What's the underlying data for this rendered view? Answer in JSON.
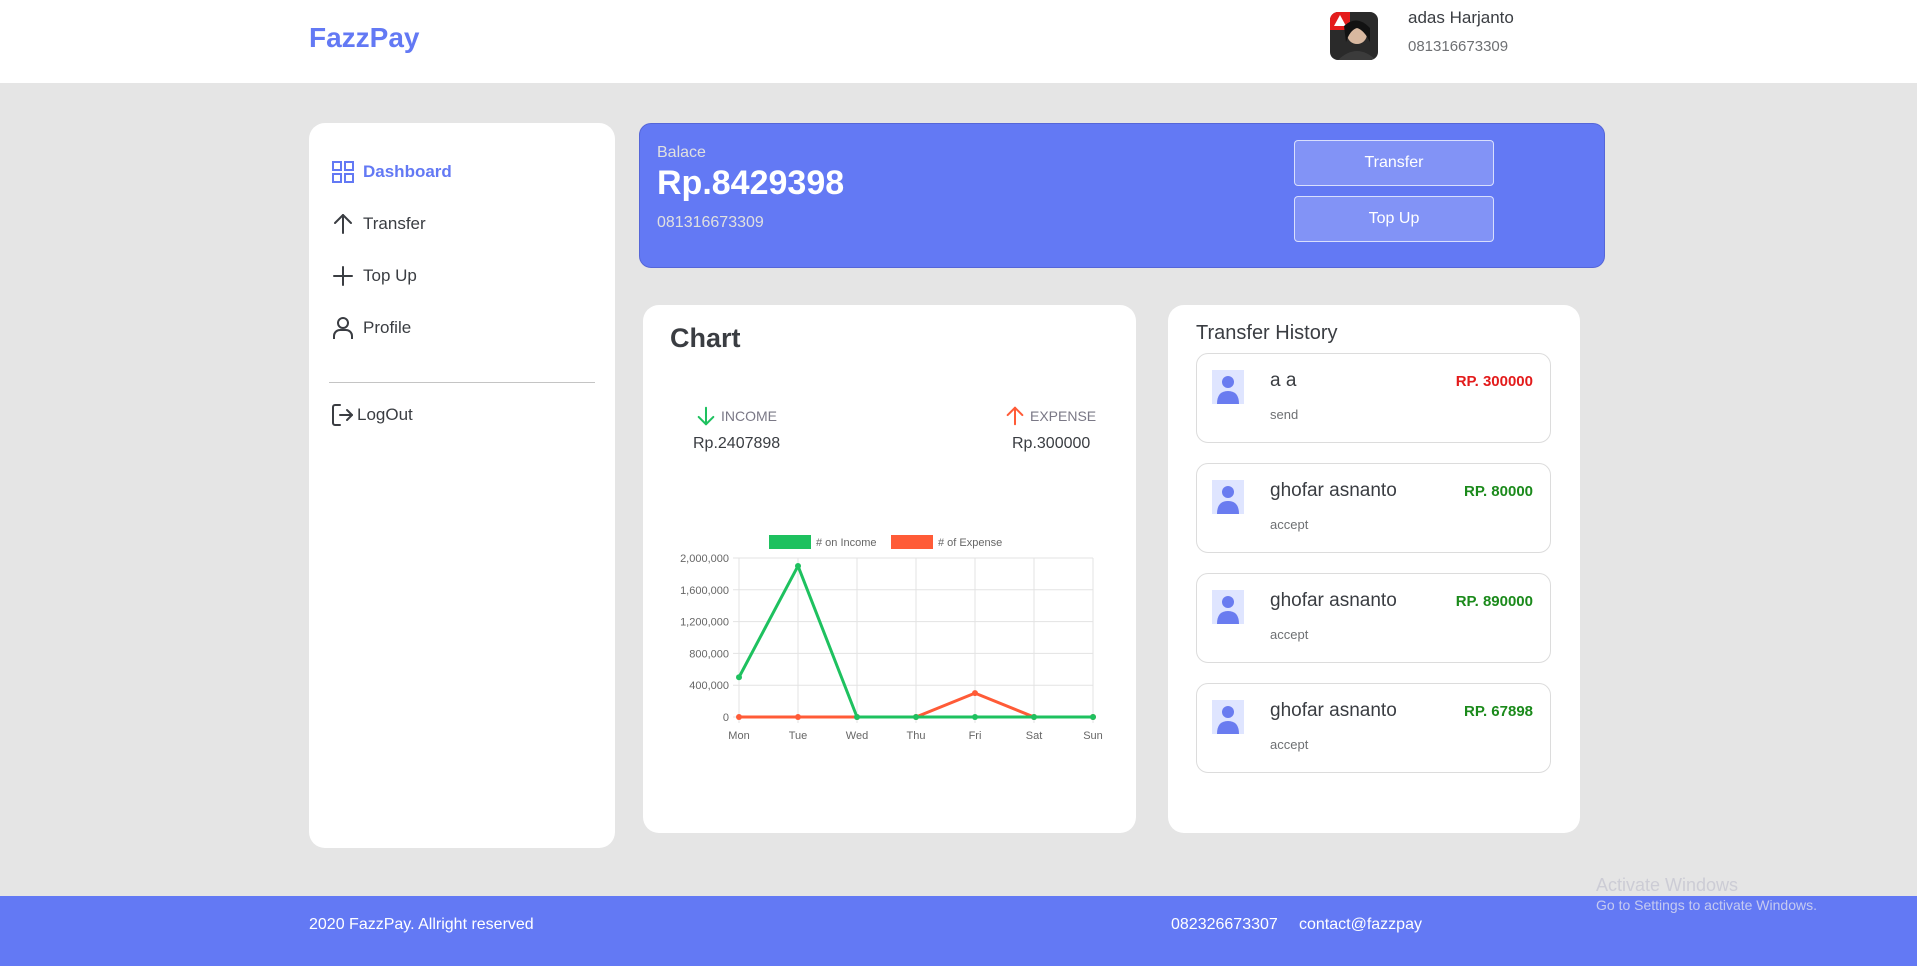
{
  "header": {
    "brand": "FazzPay",
    "user_name": "adas Harjanto",
    "user_phone": "081316673309"
  },
  "sidebar": {
    "items": [
      {
        "label": "Dashboard",
        "icon": "grid-icon"
      },
      {
        "label": "Transfer",
        "icon": "arrow-up-icon"
      },
      {
        "label": "Top Up",
        "icon": "plus-icon"
      },
      {
        "label": "Profile",
        "icon": "user-icon"
      }
    ],
    "logout": "LogOut"
  },
  "balance": {
    "label": "Balace",
    "amount": "Rp.8429398",
    "phone": "081316673309",
    "transfer_btn": "Transfer",
    "topup_btn": "Top Up"
  },
  "chart_card": {
    "title": "Chart",
    "income_label": "INCOME",
    "income_value": "Rp.2407898",
    "expense_label": "EXPENSE",
    "expense_value": "Rp.300000"
  },
  "chart_data": {
    "type": "line",
    "categories": [
      "Mon",
      "Tue",
      "Wed",
      "Thu",
      "Fri",
      "Sat",
      "Sun"
    ],
    "series": [
      {
        "name": "# on Income",
        "color": "#1ec15f",
        "values": [
          500000,
          1900000,
          0,
          0,
          0,
          0,
          0
        ]
      },
      {
        "name": "# of Expense",
        "color": "#ff5b37",
        "values": [
          0,
          0,
          0,
          0,
          300000,
          0,
          0
        ]
      }
    ],
    "ylim": [
      0,
      2000000
    ],
    "yticks": [
      "0",
      "400,000",
      "800,000",
      "1,200,000",
      "1,600,000",
      "2,000,000"
    ],
    "ytick_values": [
      0,
      400000,
      800000,
      1200000,
      1600000,
      2000000
    ],
    "legend": "top",
    "grid": true
  },
  "history": {
    "title": "Transfer History",
    "items": [
      {
        "name": "a a",
        "status": "send",
        "amount": "RP. 300000",
        "color": "#e31b1b"
      },
      {
        "name": "ghofar asnanto",
        "status": "accept",
        "amount": "RP. 80000",
        "color": "#1b8a1b"
      },
      {
        "name": "ghofar asnanto",
        "status": "accept",
        "amount": "RP. 890000",
        "color": "#1b8a1b"
      },
      {
        "name": "ghofar asnanto",
        "status": "accept",
        "amount": "RP. 67898",
        "color": "#1b8a1b"
      }
    ]
  },
  "footer": {
    "copyright": "2020 FazzPay. Allright reserved",
    "phone": "082326673307",
    "email": "contact@fazzpay"
  },
  "watermark": {
    "line1": "Activate Windows",
    "line2": "Go to Settings to activate Windows."
  }
}
